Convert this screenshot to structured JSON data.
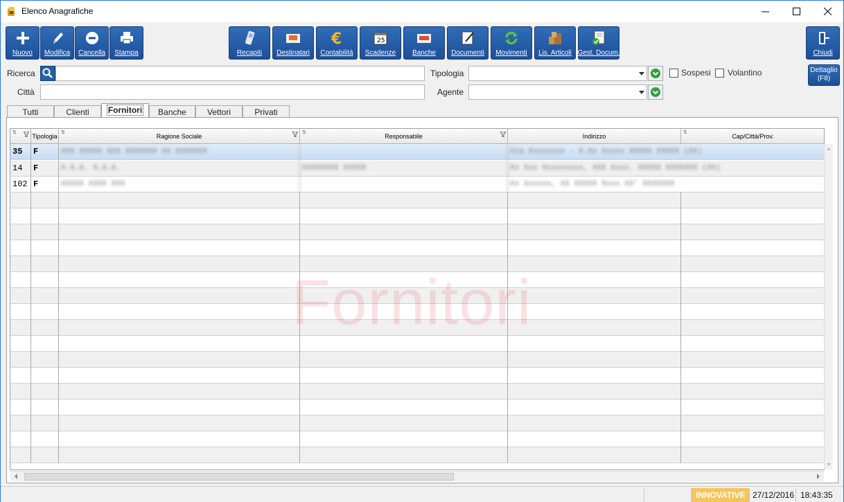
{
  "window": {
    "title": "Elenco Anagrafiche"
  },
  "toolbar": {
    "left_buttons": [
      "Nuovo",
      "Modifica",
      "Cancella",
      "Stampa"
    ],
    "center_buttons": [
      "Recapiti",
      "Destinatari",
      "Contabilità",
      "Scadenze",
      "Banche",
      "Documenti",
      "Movimenti",
      "Lis. Articoli",
      "Gest. Docum."
    ],
    "right_button": "Chiudi"
  },
  "filters": {
    "ricerca_label": "Ricerca",
    "citta_label": "Città",
    "tipologia_label": "Tipologia",
    "agente_label": "Agente",
    "sospesi_label": "Sospesi",
    "volantino_label": "Volantino",
    "dettaglio_label": "Dettaglio",
    "dettaglio_key": "(F8)"
  },
  "tabs": [
    "Tutti",
    "Clienti",
    "Fornitori",
    "Banche",
    "Vettori",
    "Privati"
  ],
  "active_tab": "Fornitori",
  "grid": {
    "columns": [
      "Tipologia",
      "Ragione Sociale",
      "Responsabile",
      "Indirizzo",
      "Cap/Città/Prov."
    ],
    "rows": [
      {
        "id": "35",
        "tipo": "F",
        "ragione": "XXX XXXXX XXX XXXXXXX XX XXXXXXX",
        "responsabile": "",
        "indirizzo": "Via Xxxxxxxx - X.Xx Xxxxx XXXXX XXXXX (XX)"
      },
      {
        "id": "14",
        "tipo": "F",
        "ragione": "X.X.X. X.X.X.",
        "responsabile": "XXXXXXXX XXXXX",
        "indirizzo": "Xx Xxx Xxxxxxxxx, XXX Xxxx. XXXXX XXXXXXX (XX)"
      },
      {
        "id": "102",
        "tipo": "F",
        "ragione": "XXXXX XXXX XXX",
        "responsabile": "",
        "indirizzo": "Xx Xxxxxx, XX  XXXXX Xxxx XX' XXXXXXX"
      }
    ],
    "watermark": "Fornitori"
  },
  "status": {
    "brand": "INNOVATIVE",
    "date": "27/12/2016",
    "time": "18:43:35"
  }
}
